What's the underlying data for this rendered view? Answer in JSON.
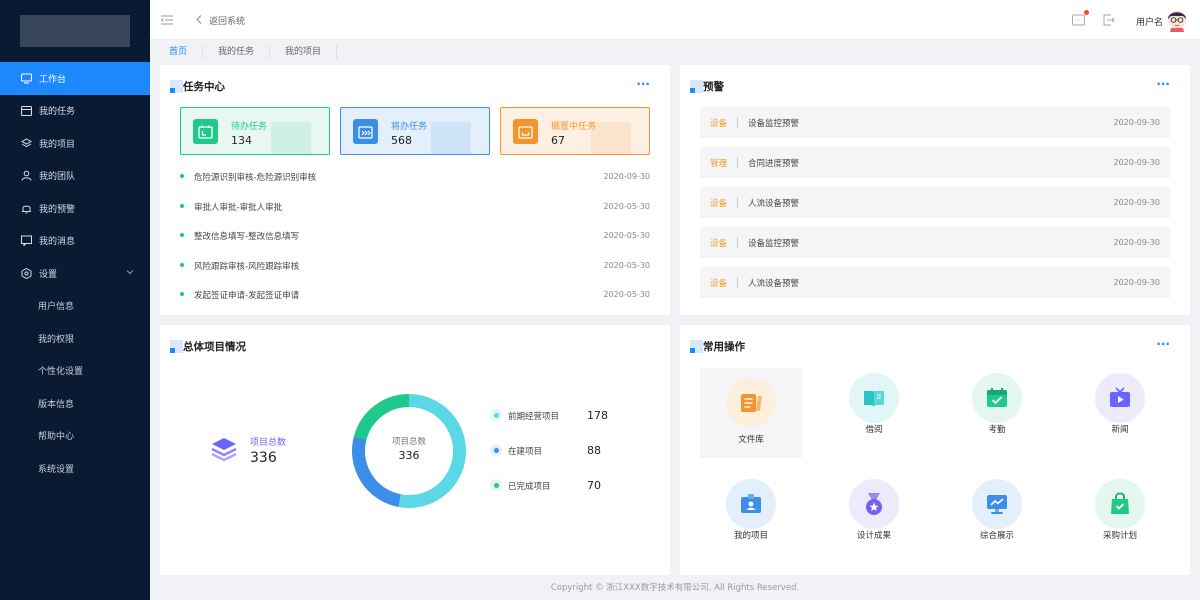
{
  "sidebar": {
    "items": [
      {
        "label": "工作台",
        "icon": "monitor-icon"
      },
      {
        "label": "我的任务",
        "icon": "calendar-icon"
      },
      {
        "label": "我的项目",
        "icon": "layers-icon"
      },
      {
        "label": "我的团队",
        "icon": "user-icon"
      },
      {
        "label": "我的预警",
        "icon": "bell-icon"
      },
      {
        "label": "我的消息",
        "icon": "message-icon"
      },
      {
        "label": "设置",
        "icon": "settings-hexagon-icon"
      }
    ],
    "sub_items": [
      "用户信息",
      "我的权限",
      "个性化设置",
      "版本信息",
      "帮助中心",
      "系统设置"
    ]
  },
  "header": {
    "back_label": "返回系统",
    "username": "用户名"
  },
  "tabs": [
    "首页",
    "我的任务",
    "我的项目"
  ],
  "task_center": {
    "title": "任务中心",
    "more": "···",
    "boxes": [
      {
        "label": "待办任务",
        "count": "134",
        "color": "#1ec98b",
        "bg": "#e8f8f1"
      },
      {
        "label": "将办任务",
        "count": "568",
        "color": "#3d8ee8",
        "bg": "#e3effb"
      },
      {
        "label": "搁置中任务",
        "count": "67",
        "color": "#f5942c",
        "bg": "#fdf0e3"
      }
    ],
    "list": [
      {
        "name": "危险源识别审核-危险源识别审核",
        "date": "2020-09-30"
      },
      {
        "name": "审批人审批-审批人审批",
        "date": "2020-05-30"
      },
      {
        "name": "整改信息填写-整改信息填写",
        "date": "2020-05-30"
      },
      {
        "name": "风险跟踪审核-风险跟踪审核",
        "date": "2020-05-30"
      },
      {
        "name": "发起签证申请-发起签证申请",
        "date": "2020-05-30"
      }
    ]
  },
  "warnings": {
    "title": "预警",
    "more": "···",
    "list": [
      {
        "type": "设备",
        "name": "设备监控预警",
        "date": "2020-09-30"
      },
      {
        "type": "管理",
        "name": "合同进度预警",
        "date": "2020-09-30"
      },
      {
        "type": "设备",
        "name": "人流设备预警",
        "date": "2020-09-30"
      },
      {
        "type": "设备",
        "name": "设备监控预警",
        "date": "2020-09-30"
      },
      {
        "type": "设备",
        "name": "人流设备预警",
        "date": "2020-09-30"
      }
    ]
  },
  "projects": {
    "title": "总体项目情况",
    "total_label": "项目总数",
    "total_value": "336",
    "donut_label": "项目总数",
    "donut_value": "336",
    "legend": [
      {
        "name": "前期经营项目",
        "value": "178",
        "color": "#5ad8e6"
      },
      {
        "name": "在建项目",
        "value": "88",
        "color": "#3d8ee8"
      },
      {
        "name": "已完成项目",
        "value": "70",
        "color": "#1ec98b"
      }
    ]
  },
  "common_ops": {
    "title": "常用操作",
    "more": "···",
    "items": [
      {
        "label": "文件库",
        "icon": "file-library-icon",
        "color": "#f5942c",
        "bg": "#fdeede"
      },
      {
        "label": "借阅",
        "icon": "book-icon",
        "color": "#2bc4c4",
        "bg": "#e1f6f6"
      },
      {
        "label": "考勤",
        "icon": "attendance-calendar-icon",
        "color": "#1ec98b",
        "bg": "#e3f7ee"
      },
      {
        "label": "新闻",
        "icon": "tv-news-icon",
        "color": "#6c63ff",
        "bg": "#ecebfc"
      },
      {
        "label": "我的项目",
        "icon": "id-card-icon",
        "color": "#3d8ee8",
        "bg": "#e3effb"
      },
      {
        "label": "设计成果",
        "icon": "medal-icon",
        "color": "#7a5cf5",
        "bg": "#ecebfc"
      },
      {
        "label": "综合展示",
        "icon": "display-chart-icon",
        "color": "#3d8ee8",
        "bg": "#e3effb"
      },
      {
        "label": "采购计划",
        "icon": "shopping-bag-icon",
        "color": "#1ec98b",
        "bg": "#e3f7ee"
      }
    ]
  },
  "footer": "Copyright © 浙江XXX数字技术有限公司, All Rights Reserved."
}
